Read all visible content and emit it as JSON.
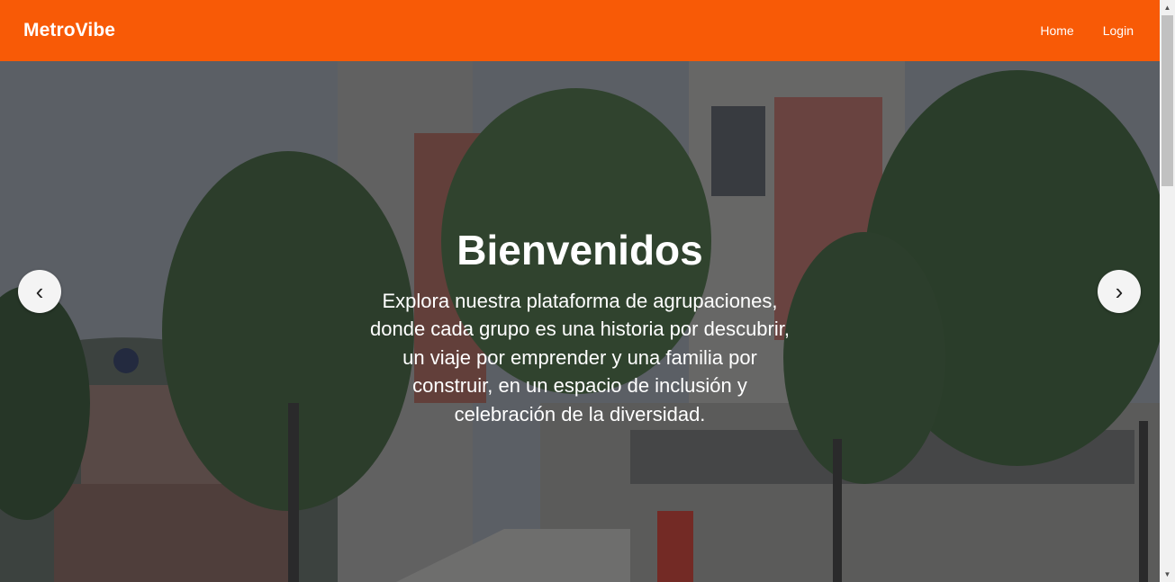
{
  "navbar": {
    "brand": "MetroVibe",
    "links": [
      "Home",
      "Login"
    ],
    "background_color": "#f85a06"
  },
  "hero": {
    "title": "Bienvenidos",
    "text": "Explora nuestra plataforma de agrupaciones, donde cada grupo es una historia por descubrir, un viaje por emprender y una familia por construir, en un espacio de inclusión y celebración de la diversidad.",
    "prev_icon": "chevron-left-icon",
    "next_icon": "chevron-right-icon",
    "prev_glyph": "‹",
    "next_glyph": "›"
  },
  "scrollbar": {
    "up_glyph": "▲",
    "down_glyph": "▼"
  }
}
